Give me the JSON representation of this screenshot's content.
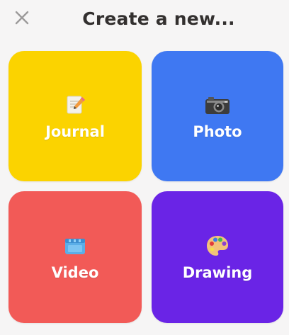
{
  "header": {
    "close_icon": "close-icon",
    "title": "Create a new..."
  },
  "tiles": [
    {
      "label": "Journal",
      "icon": "notepad-pencil-icon",
      "color": "#fbd300"
    },
    {
      "label": "Photo",
      "icon": "camera-icon",
      "color": "#3f78f2"
    },
    {
      "label": "Video",
      "icon": "video-icon",
      "color": "#f25a57"
    },
    {
      "label": "Drawing",
      "icon": "palette-icon",
      "color": "#6a24e6"
    }
  ]
}
